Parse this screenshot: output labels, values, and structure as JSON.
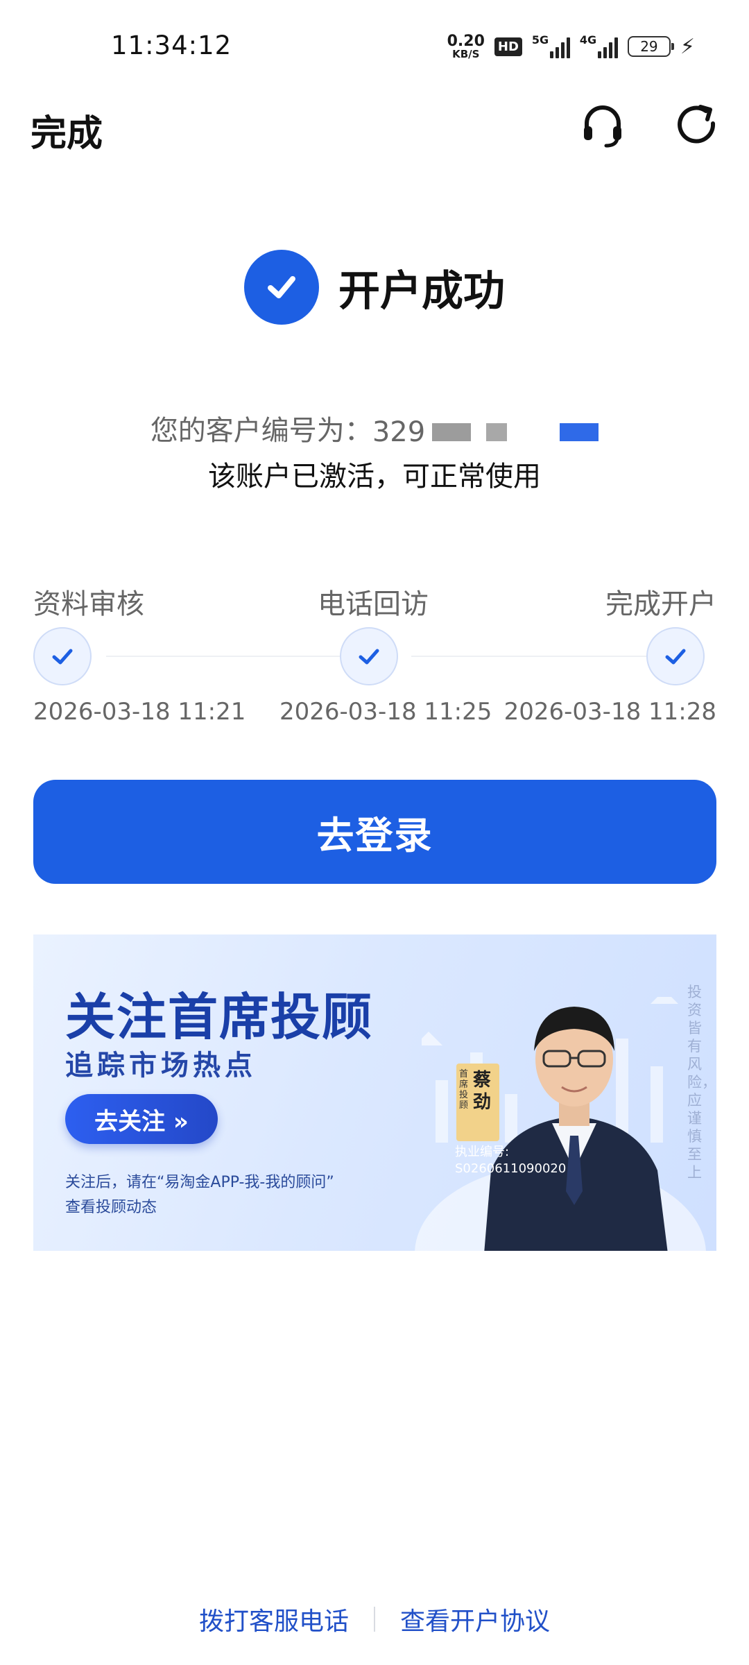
{
  "status_bar": {
    "time": "11:34:12",
    "net_speed_value": "0.20",
    "net_speed_unit": "KB/S",
    "hd_label": "HD",
    "signal_1_label": "5G",
    "signal_2_label": "4G",
    "battery": "29"
  },
  "header": {
    "done_label": "完成",
    "headset_icon": "headset-icon",
    "refresh_icon": "refresh-icon"
  },
  "success": {
    "title": "开户成功",
    "customer_label": "您的客户编号为：",
    "customer_number_visible": "329",
    "activated_text": "该账户已激活，可正常使用"
  },
  "steps": [
    {
      "label": "资料审核",
      "time": "2026-03-18 11:21"
    },
    {
      "label": "电话回访",
      "time": "2026-03-18 11:25"
    },
    {
      "label": "完成开户",
      "time": "2026-03-18 11:28"
    }
  ],
  "login_button": "去登录",
  "banner": {
    "title": "关注首席投顾",
    "subtitle": "追踪市场热点",
    "follow_button": "去关注 »",
    "note_line1": "关注后，请在“易淘金APP-我-我的顾问”",
    "note_line2": "查看投顾动态",
    "disclaimer": "投资皆有风险，应谨慎至上",
    "advisor_role": "首席投顾",
    "advisor_name": "蔡劲",
    "license_label": "执业编号:",
    "license_number": "S0260611090020"
  },
  "footer": {
    "call_service": "拨打客服电话",
    "view_agreement": "查看开户协议"
  },
  "colors": {
    "primary": "#1d5fe3",
    "link": "#2150c8"
  }
}
